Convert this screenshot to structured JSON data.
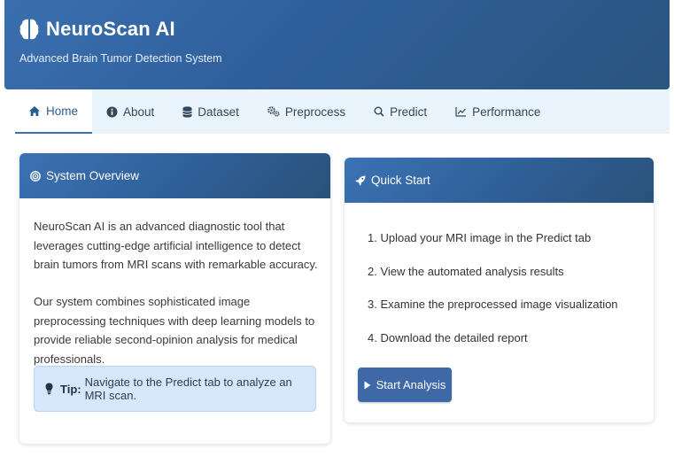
{
  "header": {
    "title": "NeuroScan AI",
    "subtitle": "Advanced Brain Tumor Detection System",
    "brand_icon": "brain-icon"
  },
  "nav": [
    {
      "label": "Home",
      "icon": "home-icon",
      "active": true
    },
    {
      "label": "About",
      "icon": "info-icon",
      "active": false
    },
    {
      "label": "Dataset",
      "icon": "database-icon",
      "active": false
    },
    {
      "label": "Preprocess",
      "icon": "gears-icon",
      "active": false
    },
    {
      "label": "Predict",
      "icon": "search-icon",
      "active": false
    },
    {
      "label": "Performance",
      "icon": "chart-line-icon",
      "active": false
    }
  ],
  "overview": {
    "title": "System Overview",
    "icon": "bullseye-icon",
    "p1": "NeuroScan AI is an advanced diagnostic tool that leverages cutting-edge artificial intelligence to detect brain tumors from MRI scans with remarkable accuracy.",
    "p2": "Our system combines sophisticated image preprocessing techniques with deep learning models to provide reliable second-opinion analysis for medical professionals.",
    "tip_label": "Tip:",
    "tip_text": "Navigate to the Predict tab to analyze an MRI scan."
  },
  "quickstart": {
    "title": "Quick Start",
    "icon": "rocket-icon",
    "steps": [
      "1. Upload your MRI image in the Predict tab",
      "2. View the automated analysis results",
      "3. Examine the preprocessed image visualization",
      "4. Download the detailed report"
    ],
    "button_label": "Start Analysis"
  },
  "colors": {
    "header": "#2f5f9a",
    "nav_bg": "#e9f3fb",
    "tip_bg": "#d7e7fb",
    "button": "#3e68a6"
  }
}
